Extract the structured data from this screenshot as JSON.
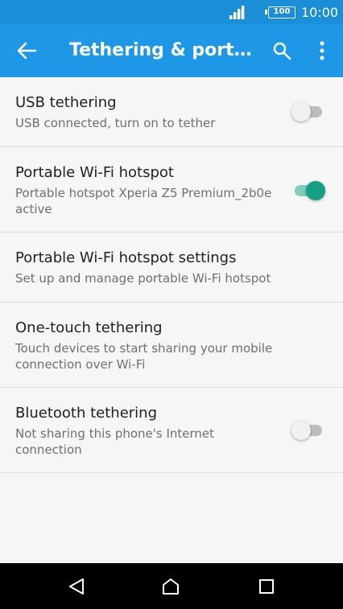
{
  "status_bar": {
    "battery": "100",
    "time": "10:00"
  },
  "app_bar": {
    "title": "Tethering & portable hotspot",
    "back_icon": "arrow-back-icon",
    "search_icon": "search-icon",
    "more_icon": "more-vert-icon"
  },
  "items": [
    {
      "primary": "USB tethering",
      "secondary": "USB connected, turn on to tether",
      "toggle": "off"
    },
    {
      "primary": "Portable Wi-Fi hotspot",
      "secondary": "Portable hotspot Xperia Z5 Premium_2b0e active",
      "toggle": "on"
    },
    {
      "primary": "Portable Wi-Fi hotspot settings",
      "secondary": "Set up and manage portable Wi-Fi hotspot"
    },
    {
      "primary": "One-touch tethering",
      "secondary": "Touch devices to start sharing your mobile connection over Wi-Fi"
    },
    {
      "primary": "Bluetooth tethering",
      "secondary": "Not sharing this phone's Internet connection",
      "toggle": "off"
    }
  ],
  "nav_bar": {
    "back_icon": "nav-back-icon",
    "home_icon": "nav-home-icon",
    "recents_icon": "nav-recents-icon"
  },
  "colors": {
    "status_bar": "#1a8fd8",
    "app_bar": "#1e97e6",
    "toggle_on_thumb": "#159f85",
    "toggle_on_track": "#7fcdbc",
    "toggle_off_track": "#bdbdbd"
  }
}
